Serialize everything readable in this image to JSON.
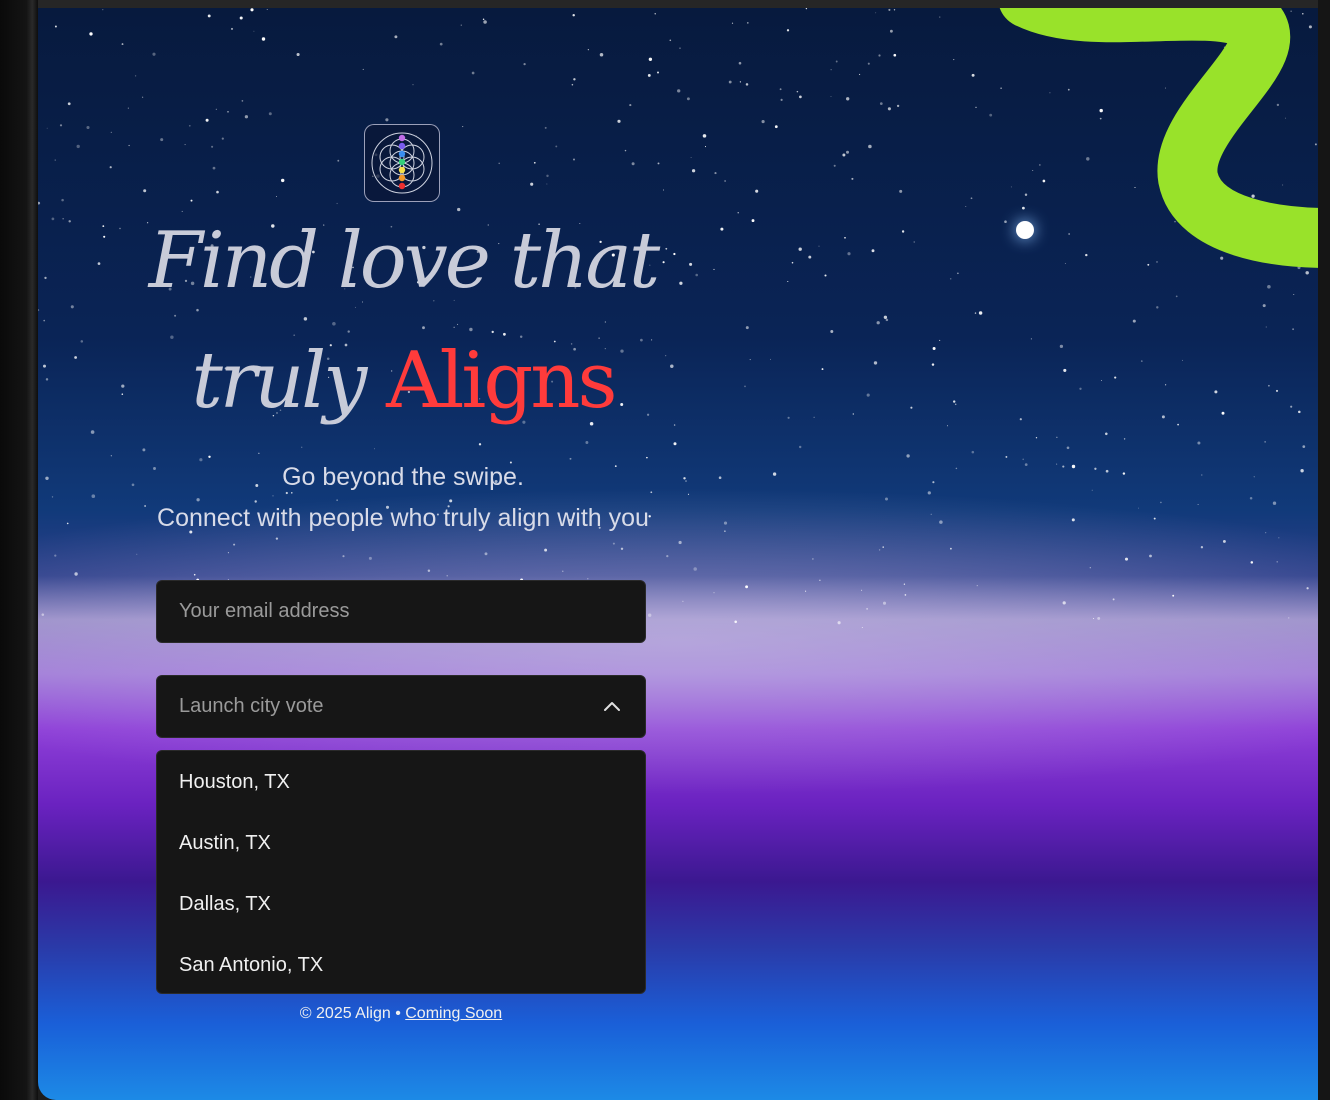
{
  "hero": {
    "headline_line1": "Find love that",
    "headline_line2_part1": "truly",
    "headline_accent": "Aligns",
    "subtitle_line1": "Go beyond the swipe.",
    "subtitle_line2": "Connect with people who truly align with you"
  },
  "form": {
    "email_placeholder": "Your email address",
    "city_select_placeholder": "Launch city vote",
    "city_options": [
      "Houston, TX",
      "Austin, TX",
      "Dallas, TX",
      "San Antonio, TX"
    ]
  },
  "footer": {
    "copyright": "© 2025 Align •",
    "link_label": "Coming Soon"
  },
  "colors": {
    "accent_red": "#ff3b3b",
    "squiggle_green": "#99e22a",
    "field_bg": "#161616"
  },
  "icons": {
    "logo": "flower-of-life-chakra-icon",
    "select_chevron": "chevron-up-icon"
  }
}
